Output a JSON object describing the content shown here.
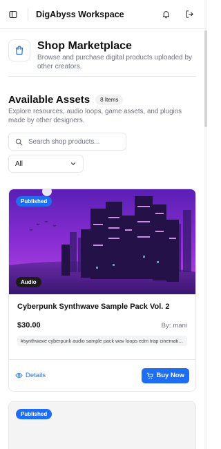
{
  "app": {
    "title": "DigAbyss Workspace"
  },
  "header": {
    "title": "Shop Marketplace",
    "description": "Browse and purchase digital products uploaded by other creators."
  },
  "assets": {
    "title": "Available Assets",
    "count_label": "8 Items",
    "description": "Explore resources, audio loops, game assets, and plugins made by other designers."
  },
  "search": {
    "placeholder": "Search shop products...",
    "value": ""
  },
  "filter": {
    "selected": "All"
  },
  "products": [
    {
      "status": "Published",
      "type": "Audio",
      "title": "Cyberpunk Synthwave Sample Pack Vol. 2",
      "price": "$30.00",
      "author_prefix": "By:",
      "author": "mani",
      "tags": "#synthwave cyberpunk audio sample pack wav loops edm trap cinematic retro",
      "details_label": "Details",
      "buy_label": "Buy Now"
    },
    {
      "status": "Published"
    }
  ],
  "colors": {
    "accent": "#1f6df0",
    "text": "#111111",
    "muted": "#6b7280",
    "border": "#e5e7eb"
  },
  "icons": {
    "sidebar_toggle": "sidebar-toggle-icon",
    "notifications": "bell-icon",
    "logout": "logout-icon",
    "shop": "shopping-bag-icon",
    "search": "search-icon",
    "chevron": "chevron-down-icon",
    "details": "eye-icon",
    "buy": "cart-icon"
  }
}
